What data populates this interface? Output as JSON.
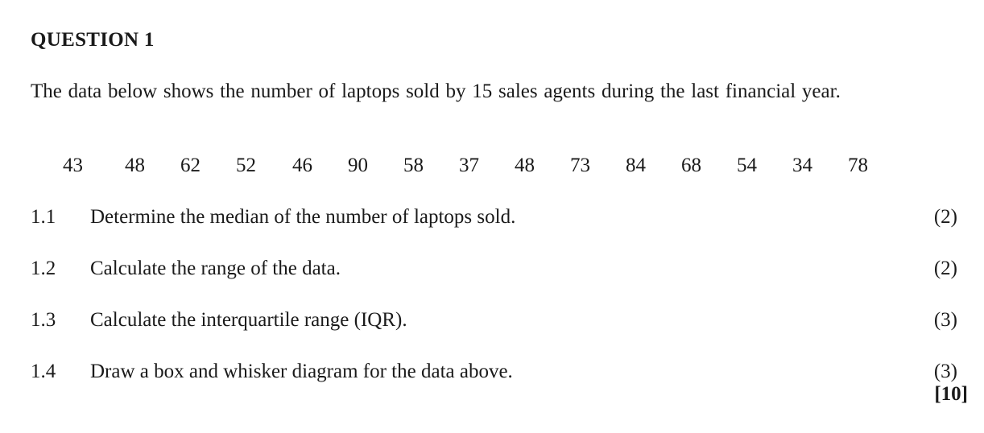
{
  "question": {
    "heading": "QUESTION 1",
    "intro": "The data below shows the number of laptops sold by 15 sales agents during the last financial year."
  },
  "data_values": [
    "43",
    "48",
    "62",
    "52",
    "46",
    "90",
    "58",
    "37",
    "48",
    "73",
    "84",
    "68",
    "54",
    "34",
    "78"
  ],
  "sub_questions": [
    {
      "number": "1.1",
      "text": "Determine the median of the number of laptops sold.",
      "marks": "(2)"
    },
    {
      "number": "1.2",
      "text": "Calculate the range of the data.",
      "marks": "(2)"
    },
    {
      "number": "1.3",
      "text": "Calculate the interquartile range (IQR).",
      "marks": "(3)"
    },
    {
      "number": "1.4",
      "text": "Draw a box and whisker diagram for the data above.",
      "marks": "(3)"
    }
  ],
  "total_marks": "[10]"
}
